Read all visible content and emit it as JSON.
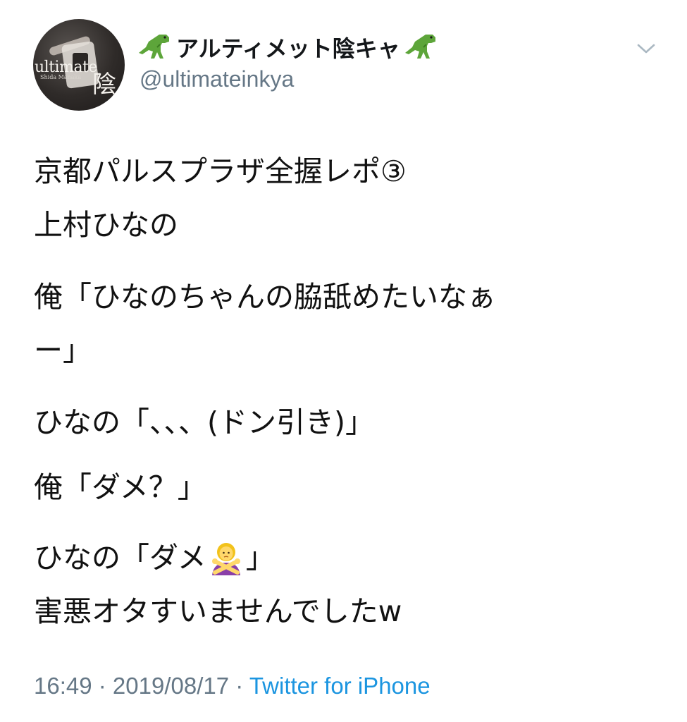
{
  "tweet": {
    "author": {
      "display_name": "アルティメット陰キャ",
      "handle": "@ultimateinkya",
      "avatar": {
        "watermark_line1": "ultimate",
        "watermark_line2": "Shida Manaka",
        "watermark_kanji": "陰"
      },
      "name_decoration_icon": "t-rex-icon"
    },
    "menu_icon": "chevron-down-icon",
    "lines": [
      "京都パルスプラザ全握レポ③",
      "上村ひなの",
      "俺「ひなのちゃんの脇舐めたいなぁ",
      "ー」",
      "ひなの「、、、(ドン引き)」",
      "俺「ダメ？」",
      "ひなの「ダメ",
      "」",
      "害悪オタすいませんでしたw"
    ],
    "inline_emoji_icon": "person-gesturing-no-icon",
    "footer": {
      "time": "16:49",
      "separator": " · ",
      "date": "2019/08/17",
      "source": "Twitter for iPhone"
    },
    "colors": {
      "text": "#111111",
      "secondary": "#657786",
      "link": "#1b95e0"
    }
  }
}
